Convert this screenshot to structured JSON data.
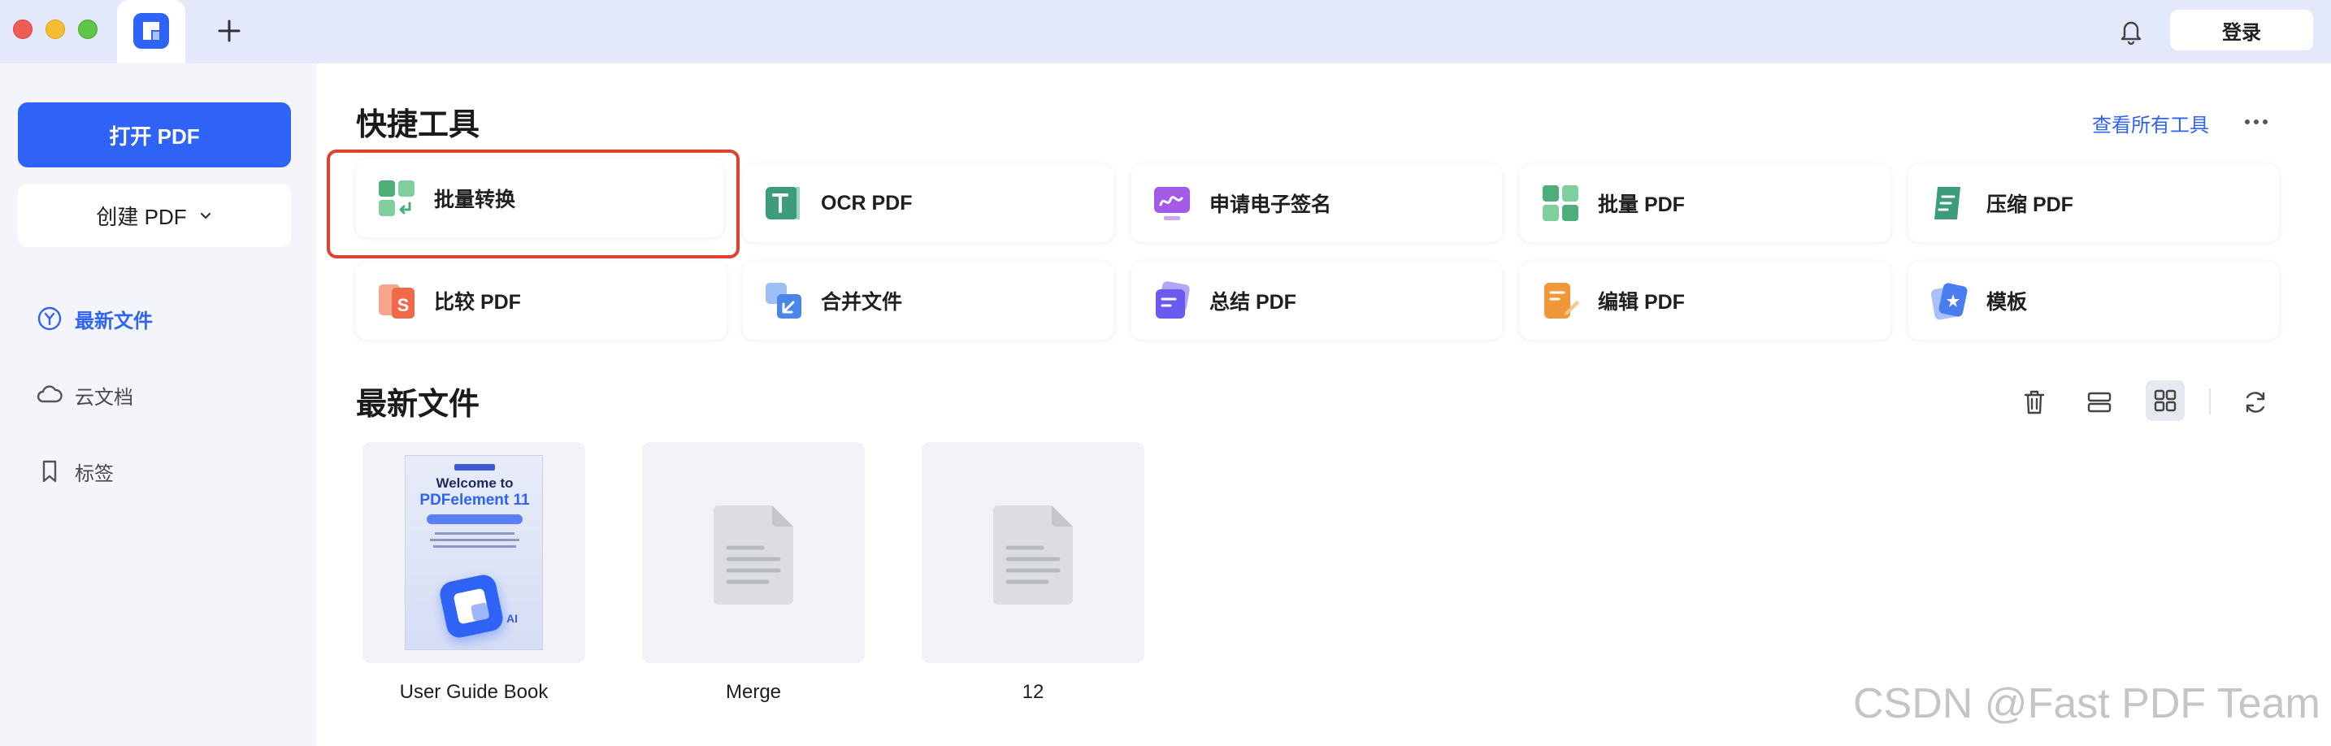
{
  "titlebar": {
    "login_label": "登录"
  },
  "sidebar": {
    "open_pdf_label": "打开 PDF",
    "create_pdf_label": "创建 PDF",
    "nav": [
      {
        "label": "最新文件",
        "icon": "recent-icon",
        "active": true
      },
      {
        "label": "云文档",
        "icon": "cloud-icon",
        "active": false
      },
      {
        "label": "标签",
        "icon": "bookmark-icon",
        "active": false
      }
    ]
  },
  "quick_tools": {
    "title": "快捷工具",
    "view_all_label": "查看所有工具",
    "tools": [
      {
        "label": "批量转换",
        "icon": "batch-convert-icon",
        "color": "#4caf7a"
      },
      {
        "label": "OCR PDF",
        "icon": "ocr-icon",
        "color": "#3d9c7a"
      },
      {
        "label": "申请电子签名",
        "icon": "esign-icon",
        "color": "#a35ae6"
      },
      {
        "label": "批量 PDF",
        "icon": "batch-pdf-icon",
        "color": "#4caf7a"
      },
      {
        "label": "压缩 PDF",
        "icon": "compress-icon",
        "color": "#3d9c7a"
      },
      {
        "label": "比较 PDF",
        "icon": "compare-icon",
        "color": "#f06a4a"
      },
      {
        "label": "合并文件",
        "icon": "merge-icon",
        "color": "#4a86e8"
      },
      {
        "label": "总结 PDF",
        "icon": "summarize-icon",
        "color": "#6a5af0"
      },
      {
        "label": "编辑 PDF",
        "icon": "edit-icon",
        "color": "#f0973a"
      },
      {
        "label": "模板",
        "icon": "template-icon",
        "color": "#4a7ef0"
      }
    ]
  },
  "recent": {
    "title": "最新文件",
    "files": [
      {
        "name": "User Guide Book",
        "thumbnail_title": "Welcome to",
        "thumbnail_subtitle": "PDFelement 11",
        "thumbnail_badge": "AI"
      },
      {
        "name": "Merge"
      },
      {
        "name": "12"
      }
    ]
  },
  "watermark": "CSDN @Fast PDF Team"
}
